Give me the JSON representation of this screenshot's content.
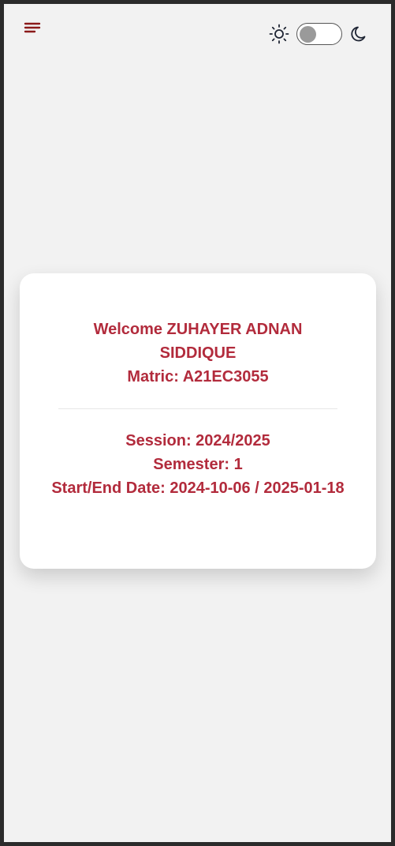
{
  "header": {
    "menu_icon": "menu-icon",
    "theme": {
      "light_icon": "sun-icon",
      "dark_icon": "moon-icon",
      "toggle_state": "light"
    }
  },
  "card": {
    "welcome": "Welcome ZUHAYER ADNAN SIDDIQUE",
    "matric": "Matric: A21EC3055",
    "session": "Session: 2024/2025",
    "semester": "Semester: 1",
    "dates": "Start/End Date: 2024-10-06 / 2025-01-18"
  },
  "colors": {
    "accent": "#b22b3c",
    "menu": "#8b1a1a",
    "background": "#f2f2f2",
    "card": "#ffffff"
  }
}
